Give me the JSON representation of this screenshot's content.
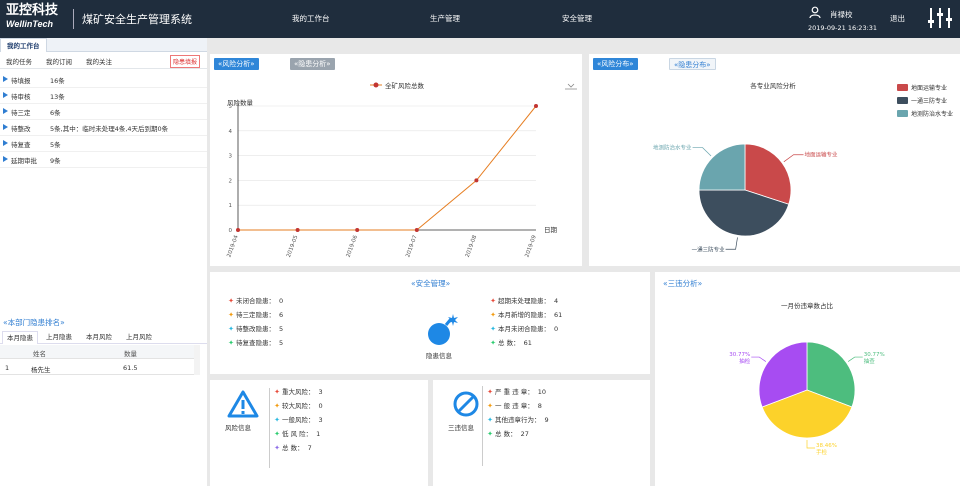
{
  "header": {
    "logo_cn": "亚控科技",
    "logo_en": "WellinTech",
    "system_title": "煤矿安全生产管理系统",
    "nav": [
      "我的工作台",
      "生产管理",
      "安全管理"
    ],
    "user_name": "肖禄校",
    "datetime": "2019-09-21 16:23:31",
    "logout": "退出"
  },
  "workspace": {
    "tab": "我的工作台",
    "subtabs": [
      "我的任务",
      "我的订阅",
      "我的关注"
    ],
    "hidden_task_btn": "隐患填报",
    "tasks": [
      {
        "label": "待填报",
        "value": "16条"
      },
      {
        "label": "待审核",
        "value": "13条"
      },
      {
        "label": "待三定",
        "value": "6条"
      },
      {
        "label": "待整改",
        "value": "5条,其中：临时未处理4条,4天后到期0条"
      },
      {
        "label": "待复查",
        "value": "5条"
      },
      {
        "label": "延期审批",
        "value": "9条"
      }
    ]
  },
  "ranking": {
    "title": "«本部门隐患排名»",
    "tabs": [
      "本月隐患",
      "上月隐患",
      "本月风险",
      "上月风险"
    ],
    "headers": [
      "姓名",
      "数量"
    ],
    "rows": [
      {
        "index": "1",
        "name": "杨先生",
        "count": "61.5"
      }
    ]
  },
  "risk_panel": {
    "btn_risk": "«风险分析»",
    "btn_hidden": "«隐患分析»",
    "legend": "全矿风险总数",
    "ylabel": "风险数量",
    "xlabel": "日期"
  },
  "chart_data": [
    {
      "type": "line",
      "ylabel": "风险数量",
      "xlabel": "日期",
      "legend": "全矿风险总数",
      "x": [
        "2019-04",
        "2019-05",
        "2019-06",
        "2019-07",
        "2019-08",
        "2019-09"
      ],
      "series": [
        {
          "name": "全矿风险总数",
          "values": [
            0,
            0,
            0,
            0,
            2,
            5
          ]
        }
      ],
      "ylim": [
        0,
        5
      ],
      "yticks": [
        "0",
        "1",
        "2",
        "3",
        "4",
        "5"
      ],
      "color": "#e67e22",
      "marker_color": "#c23531"
    },
    {
      "type": "pie",
      "title": "各专业风险分析",
      "slices": [
        {
          "name": "地面运输专业",
          "value": 30,
          "color": "#c9494a"
        },
        {
          "name": "一通三防专业",
          "value": 45,
          "color": "#3d4e5e"
        },
        {
          "name": "地测防治水专业",
          "value": 25,
          "color": "#6aa5ae"
        }
      ]
    },
    {
      "type": "pie",
      "title": "一月份违章数占比",
      "slices": [
        {
          "name": "抽查",
          "label": "30.77%",
          "value": 30.77,
          "color": "#4dbd7e"
        },
        {
          "name": "手检",
          "label": "38.46%",
          "value": 38.46,
          "color": "#fcd22a"
        },
        {
          "name": "抽检",
          "label": "30.77%",
          "value": 30.77,
          "color": "#a74cf2"
        }
      ]
    }
  ],
  "dist_panel": {
    "btn_risk": "«风险分布»",
    "btn_hidden": "«隐患分布»"
  },
  "safety": {
    "title": "«安全管理»",
    "left_items": [
      {
        "label": "未闭合隐患：",
        "value": "0",
        "color": "#e74c3c"
      },
      {
        "label": "待三定隐患：",
        "value": "6",
        "color": "#f39c12"
      },
      {
        "label": "待整改隐患：",
        "value": "5",
        "color": "#2bb9e0"
      },
      {
        "label": "待复查隐患：",
        "value": "5",
        "color": "#2ecc71"
      }
    ],
    "right_items": [
      {
        "label": "超期未处理隐患：",
        "value": "4",
        "color": "#e74c3c"
      },
      {
        "label": "本月新增的隐患：",
        "value": "61",
        "color": "#f39c12"
      },
      {
        "label": "本月未闭合隐患：",
        "value": "0",
        "color": "#2bb9e0"
      },
      {
        "label": "总      数：",
        "value": "61",
        "color": "#2ecc71"
      }
    ],
    "center_label": "隐患信息"
  },
  "risk_info": {
    "label": "风险信息",
    "items": [
      {
        "label": "重大风险：",
        "value": "3",
        "color": "#e74c3c"
      },
      {
        "label": "较大风险：",
        "value": "0",
        "color": "#f39c12"
      },
      {
        "label": "一般风险：",
        "value": "3",
        "color": "#2bb9e0"
      },
      {
        "label": "低 风 险：",
        "value": "1",
        "color": "#2ecc71"
      },
      {
        "label": "总      数：",
        "value": "7",
        "color": "#8e6ee8"
      }
    ]
  },
  "violation_info": {
    "label": "三违信息",
    "items": [
      {
        "label": "严 重 违 章：",
        "value": "10",
        "color": "#e74c3c"
      },
      {
        "label": "一 般 违 章：",
        "value": "8",
        "color": "#f39c12"
      },
      {
        "label": "其他违章行为：",
        "value": "9",
        "color": "#2bb9e0"
      },
      {
        "label": "总      数：",
        "value": "27",
        "color": "#2ecc71"
      }
    ]
  },
  "three_analysis": {
    "title": "«三违分析»"
  }
}
